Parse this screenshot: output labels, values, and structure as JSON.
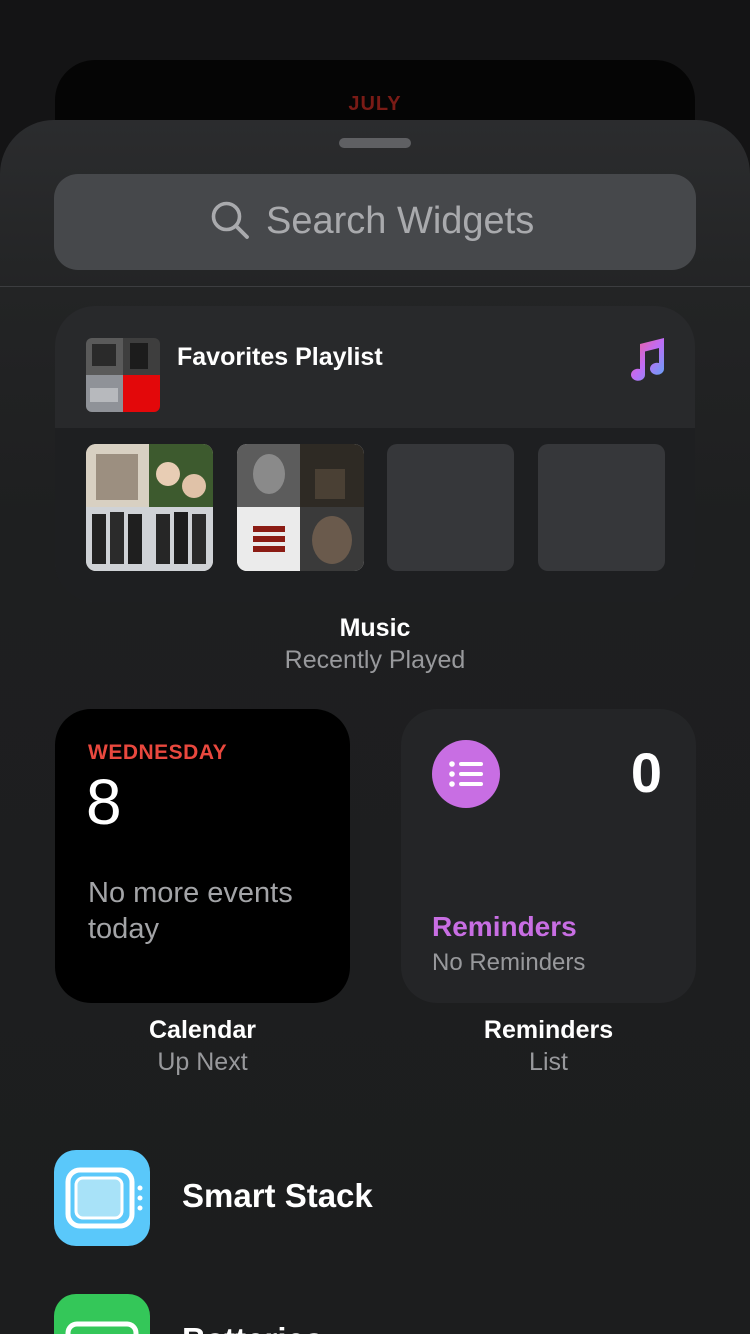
{
  "background_widget": {
    "month": "JULY"
  },
  "search": {
    "placeholder": "Search Widgets"
  },
  "music_widget": {
    "playlist_title": "Favorites Playlist",
    "albums": [
      "album-art-1",
      "album-art-2",
      "album-placeholder",
      "album-placeholder"
    ],
    "caption_title": "Music",
    "caption_subtitle": "Recently Played",
    "icon": "music-note-icon"
  },
  "calendar_widget": {
    "day": "WEDNESDAY",
    "date": "8",
    "events": "No more events today",
    "caption_title": "Calendar",
    "caption_subtitle": "Up Next"
  },
  "reminders_widget": {
    "count": "0",
    "title": "Reminders",
    "subtitle": "No Reminders",
    "caption_title": "Reminders",
    "caption_subtitle": "List",
    "icon": "list-bullet-icon"
  },
  "app_list": [
    {
      "name": "Smart Stack",
      "icon": "smart-stack-icon"
    },
    {
      "name": "Batteries",
      "icon": "batteries-icon"
    }
  ],
  "colors": {
    "accent_red": "#e9483e",
    "reminders_purple": "#c86ee3",
    "smart_stack_blue": "#5ac8fa",
    "batteries_green": "#34c759"
  }
}
